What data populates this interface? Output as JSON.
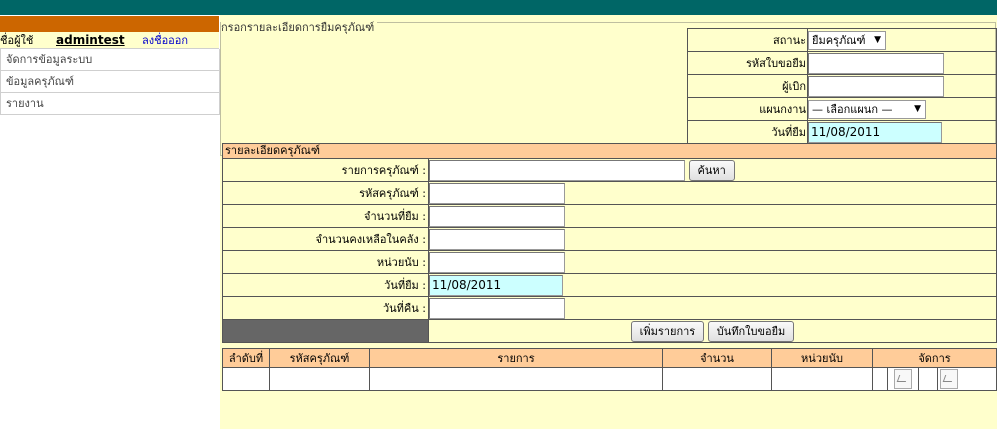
{
  "colors": {
    "topbar": "#006666",
    "sidebar_header": "#cc6600",
    "panel_bg": "#ffffcc",
    "section_header": "#ffcc99",
    "date_bg": "#ccffff"
  },
  "user": {
    "label": "ชื่อผู้ใช้",
    "name": "admintest",
    "logout": "ลงชื่อออก"
  },
  "sidebar": {
    "items": [
      {
        "label": "จัดการข้อมูลระบบ"
      },
      {
        "label": "ข้อมูลครุภัณฑ์"
      },
      {
        "label": "รายงาน"
      }
    ]
  },
  "form": {
    "legend": "กรอกรายละเอียดการยืมครุภัณฑ์",
    "status": {
      "label": "สถานะ",
      "value": "ยืมครุภัณฑ์"
    },
    "borrow_no": {
      "label": "รหัสใบขอยืม",
      "value": ""
    },
    "requester": {
      "label": "ผู้เบิก",
      "value": ""
    },
    "department": {
      "label": "แผนกงาน",
      "value": "— เลือกแผนก —"
    },
    "borrow_date": {
      "label": "วันที่ยืม",
      "value": "11/08/2011"
    }
  },
  "detail": {
    "title": "รายละเอียดครุภัณฑ์",
    "item": {
      "label": "รายการครุภัณฑ์ :",
      "value": ""
    },
    "search_button": "ค้นหา",
    "code": {
      "label": "รหัสครุภัณฑ์ :",
      "value": ""
    },
    "qty": {
      "label": "จำนวนที่ยืม :",
      "value": ""
    },
    "stock": {
      "label": "จำนวนคงเหลือในคลัง :",
      "value": ""
    },
    "unit": {
      "label": "หน่วยนับ :",
      "value": ""
    },
    "borrow_date": {
      "label": "วันที่ยืม :",
      "value": "11/08/2011"
    },
    "return_date": {
      "label": "วันที่คืน :",
      "value": ""
    },
    "add_button": "เพิ่มรายการ",
    "save_button": "บันทึกใบขอยืม"
  },
  "list": {
    "headers": {
      "seq": "ลำดับที่",
      "code": "รหัสครุภัณฑ์",
      "item": "รายการ",
      "qty": "จำนวน",
      "unit": "หน่วยนับ",
      "manage": "จัดการ"
    },
    "edit_icon": "document-icon",
    "delete_icon": "document-icon"
  }
}
